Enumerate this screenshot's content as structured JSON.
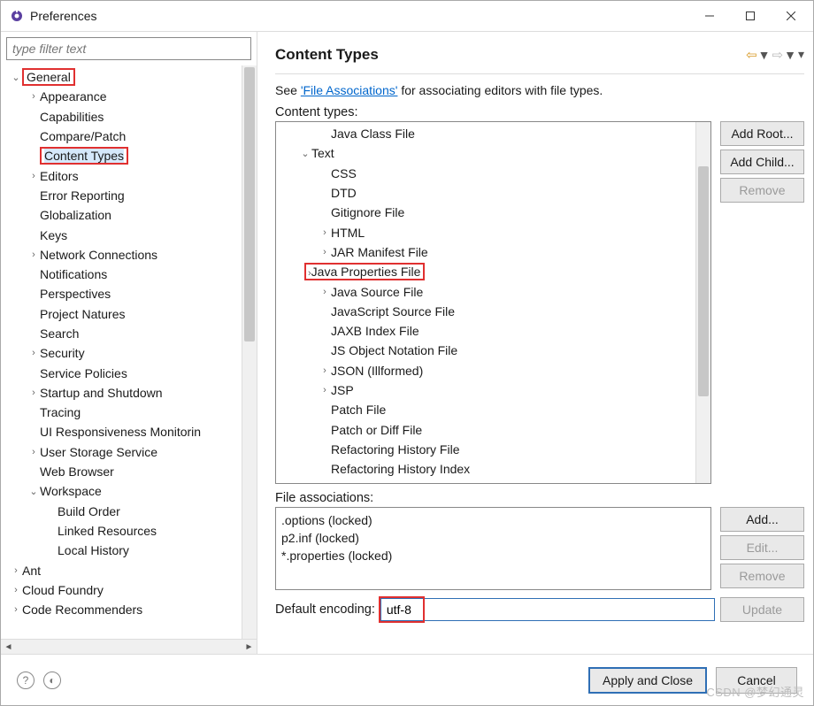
{
  "window": {
    "title": "Preferences"
  },
  "filter": {
    "placeholder": "type filter text"
  },
  "header": {
    "title": "Content Types",
    "desc_prefix": "See ",
    "desc_link": "'File Associations'",
    "desc_suffix": " for associating editors with file types."
  },
  "labels": {
    "content_types": "Content types:",
    "file_assoc": "File associations:",
    "default_enc": "Default encoding:"
  },
  "buttons": {
    "add_root": "Add Root...",
    "add_child": "Add Child...",
    "remove": "Remove",
    "add": "Add...",
    "edit": "Edit...",
    "remove2": "Remove",
    "update": "Update",
    "apply": "Apply and Close",
    "cancel": "Cancel"
  },
  "sidebar": [
    {
      "d": 0,
      "tw": "v",
      "label": "General",
      "red": true
    },
    {
      "d": 1,
      "tw": ">",
      "label": "Appearance"
    },
    {
      "d": 1,
      "tw": "",
      "label": "Capabilities"
    },
    {
      "d": 1,
      "tw": "",
      "label": "Compare/Patch"
    },
    {
      "d": 1,
      "tw": "",
      "label": "Content Types",
      "red": true,
      "sel": true
    },
    {
      "d": 1,
      "tw": ">",
      "label": "Editors"
    },
    {
      "d": 1,
      "tw": "",
      "label": "Error Reporting"
    },
    {
      "d": 1,
      "tw": "",
      "label": "Globalization"
    },
    {
      "d": 1,
      "tw": "",
      "label": "Keys"
    },
    {
      "d": 1,
      "tw": ">",
      "label": "Network Connections"
    },
    {
      "d": 1,
      "tw": "",
      "label": "Notifications"
    },
    {
      "d": 1,
      "tw": "",
      "label": "Perspectives"
    },
    {
      "d": 1,
      "tw": "",
      "label": "Project Natures"
    },
    {
      "d": 1,
      "tw": "",
      "label": "Search"
    },
    {
      "d": 1,
      "tw": ">",
      "label": "Security"
    },
    {
      "d": 1,
      "tw": "",
      "label": "Service Policies"
    },
    {
      "d": 1,
      "tw": ">",
      "label": "Startup and Shutdown"
    },
    {
      "d": 1,
      "tw": "",
      "label": "Tracing"
    },
    {
      "d": 1,
      "tw": "",
      "label": "UI Responsiveness Monitorin"
    },
    {
      "d": 1,
      "tw": ">",
      "label": "User Storage Service"
    },
    {
      "d": 1,
      "tw": "",
      "label": "Web Browser"
    },
    {
      "d": 1,
      "tw": "v",
      "label": "Workspace"
    },
    {
      "d": 2,
      "tw": "",
      "label": "Build Order"
    },
    {
      "d": 2,
      "tw": "",
      "label": "Linked Resources"
    },
    {
      "d": 2,
      "tw": "",
      "label": "Local History"
    },
    {
      "d": 0,
      "tw": ">",
      "label": "Ant"
    },
    {
      "d": 0,
      "tw": ">",
      "label": "Cloud Foundry"
    },
    {
      "d": 0,
      "tw": ">",
      "label": "Code Recommenders"
    }
  ],
  "ctree": [
    {
      "d": 1,
      "tw": "",
      "label": "Java Class File"
    },
    {
      "d": 0,
      "tw": "v",
      "label": "Text"
    },
    {
      "d": 1,
      "tw": "",
      "label": "CSS"
    },
    {
      "d": 1,
      "tw": "",
      "label": "DTD"
    },
    {
      "d": 1,
      "tw": "",
      "label": "Gitignore File"
    },
    {
      "d": 1,
      "tw": ">",
      "label": "HTML"
    },
    {
      "d": 1,
      "tw": ">",
      "label": "JAR Manifest File"
    },
    {
      "d": 1,
      "tw": ">",
      "label": "Java Properties File",
      "red": true
    },
    {
      "d": 1,
      "tw": ">",
      "label": "Java Source File"
    },
    {
      "d": 1,
      "tw": "",
      "label": "JavaScript Source File"
    },
    {
      "d": 1,
      "tw": "",
      "label": "JAXB Index File"
    },
    {
      "d": 1,
      "tw": "",
      "label": "JS Object Notation File"
    },
    {
      "d": 1,
      "tw": ">",
      "label": "JSON (Illformed)"
    },
    {
      "d": 1,
      "tw": ">",
      "label": "JSP"
    },
    {
      "d": 1,
      "tw": "",
      "label": "Patch File"
    },
    {
      "d": 1,
      "tw": "",
      "label": "Patch or Diff File"
    },
    {
      "d": 1,
      "tw": "",
      "label": "Refactoring History File"
    },
    {
      "d": 1,
      "tw": "",
      "label": "Refactoring History Index"
    }
  ],
  "file_assoc": [
    ".options (locked)",
    "p2.inf (locked)",
    "*.properties (locked)"
  ],
  "encoding": {
    "value": "utf-8"
  },
  "watermark": "CSDN @梦幻通灵"
}
